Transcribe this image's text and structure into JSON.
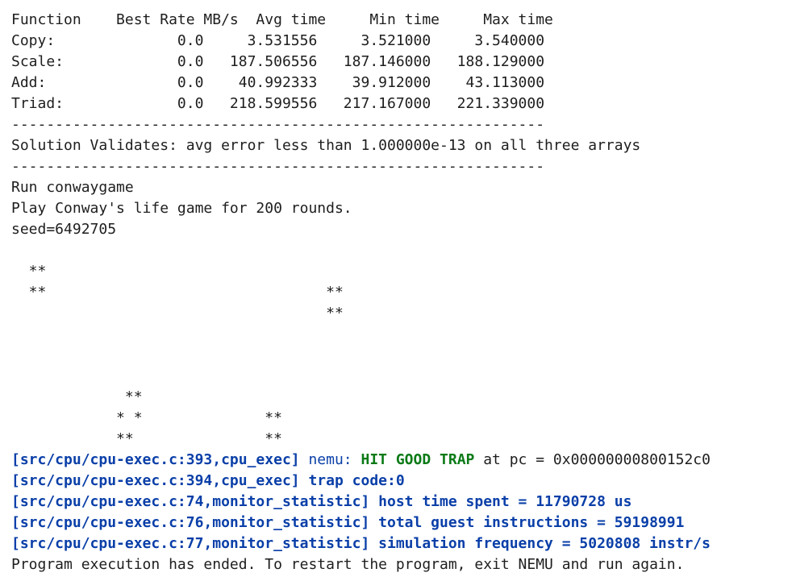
{
  "stream_table": {
    "header": "Function    Best Rate MB/s  Avg time     Min time     Max time",
    "rows": [
      "Copy:              0.0     3.531556     3.521000     3.540000",
      "Scale:             0.0   187.506556   187.146000   188.129000",
      "Add:               0.0    40.992333    39.912000    43.113000",
      "Triad:             0.0   218.599556   217.167000   221.339000"
    ]
  },
  "separator": "-------------------------------------------------------------",
  "validation": "Solution Validates: avg error less than 1.000000e-13 on all three arrays",
  "conway": {
    "run_line": "Run conwaygame",
    "play_line": "Play Conway's life game for 200 rounds.",
    "seed_line": "seed=6492705",
    "grid": [
      "",
      "  **",
      "  **                                **",
      "                                    **",
      "",
      "",
      "",
      "             **",
      "            * *              **",
      "            **               **"
    ]
  },
  "nemu_log": {
    "trap_prefix": "[src/cpu/cpu-exec.c:393,cpu_exec]",
    "trap_nemu": " nemu: ",
    "trap_status": "HIT GOOD TRAP",
    "trap_suffix": " at pc = 0x00000000800152c0",
    "trap_code": "[src/cpu/cpu-exec.c:394,cpu_exec] trap code:0",
    "host_time": "[src/cpu/cpu-exec.c:74,monitor_statistic] host time spent = 11790728 us",
    "guest_instructions": "[src/cpu/cpu-exec.c:76,monitor_statistic] total guest instructions = 59198991",
    "sim_frequency": "[src/cpu/cpu-exec.c:77,monitor_statistic] simulation frequency = 5020808 instr/s"
  },
  "ended_message": "Program execution has ended. To restart the program, exit NEMU and run again.",
  "colors": {
    "text": "#1e1e1e",
    "log_blue": "#0a3fa8",
    "good_green": "#0a7a16",
    "background": "#ffffff"
  }
}
